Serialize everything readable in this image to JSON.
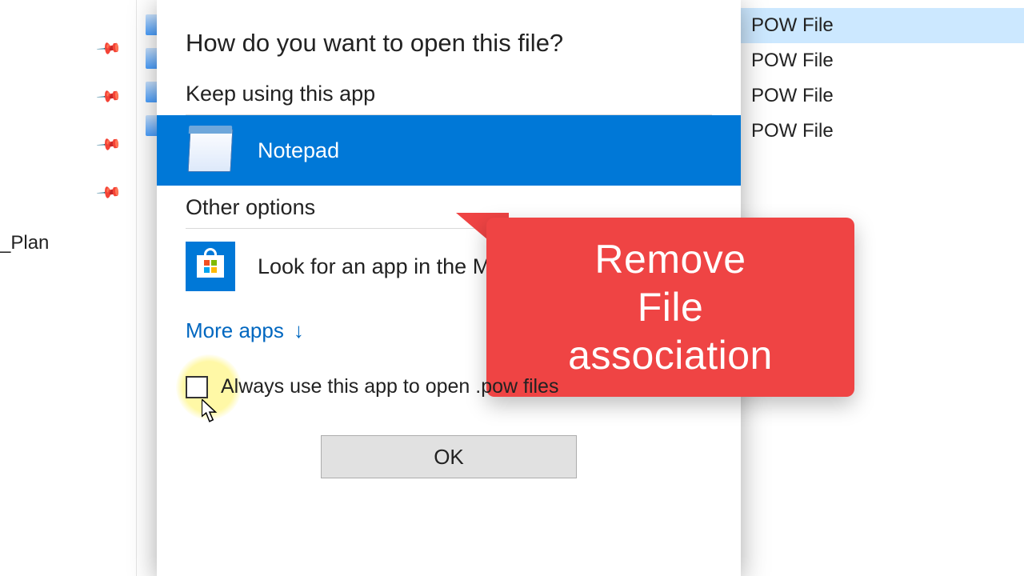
{
  "sidebar": {
    "pin_count": 4,
    "item_fragment": "_Plan"
  },
  "file_column": {
    "rows": [
      "POW File",
      "POW File",
      "POW File",
      "POW File"
    ]
  },
  "dialog": {
    "title": "How do you want to open this file?",
    "keep_using_label": "Keep using this app",
    "selected_app": "Notepad",
    "other_options_label": "Other options",
    "store_row_label": "Look for an app in the Microsoft Store",
    "more_apps_label": "More apps",
    "more_apps_arrow": "↓",
    "always_label": "Always use this app to open .pow files",
    "ok_label": "OK"
  },
  "callout": {
    "line1": "Remove",
    "line2": "File",
    "line3": "association"
  }
}
